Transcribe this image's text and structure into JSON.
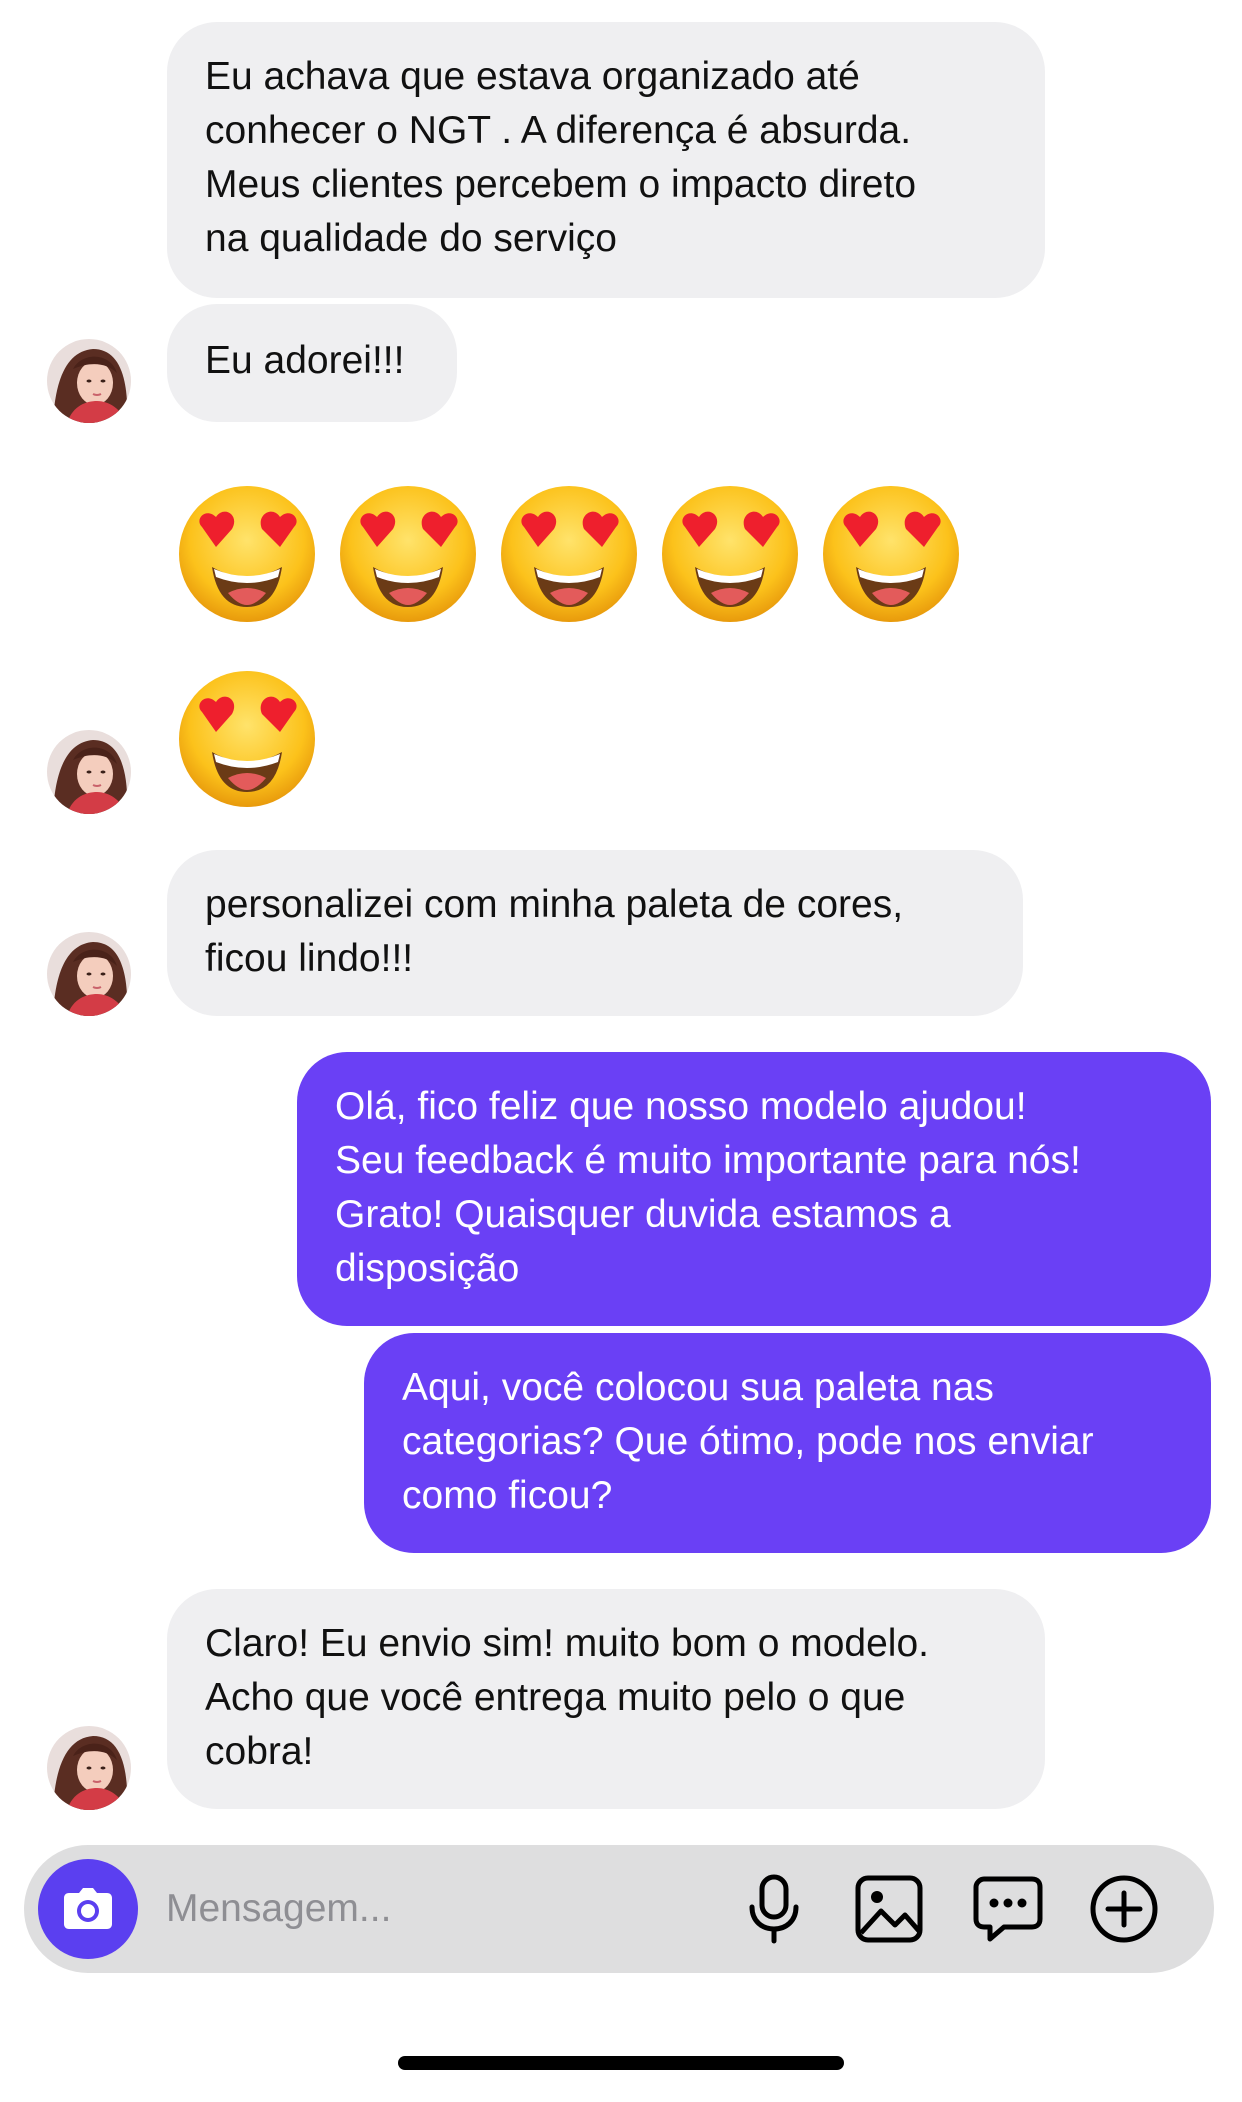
{
  "messages": {
    "m1": "Eu achava que estava organizado até\nconhecer o NGT . A diferença é absurda.\nMeus clientes percebem o impacto direto\nna qualidade do serviço",
    "m2": "Eu adorei!!!",
    "emoji_row1": [
      "😍",
      "😍",
      "😍",
      "😍",
      "😍"
    ],
    "emoji_row2": [
      "😍"
    ],
    "m3": "personalizei com minha paleta de cores,\nficou lindo!!!",
    "m4": "Olá, fico feliz que nosso modelo ajudou!\nSeu feedback é muito importante para nós!\nGrato! Quaisquer duvida estamos a\ndisposição",
    "m5": "Aqui, você colocou sua paleta nas\ncategorias? Que ótimo, pode nos enviar\ncomo ficou?",
    "m6": "Claro! Eu envio sim! muito bom o modelo.\nAcho que você entrega muito pelo o que\ncobra!"
  },
  "composer": {
    "placeholder": "Mensagem...",
    "icons": [
      "camera-icon",
      "microphone-icon",
      "image-icon",
      "chat-bubble-icon",
      "plus-circle-icon"
    ]
  },
  "colors": {
    "incoming_bubble": "#efeff1",
    "outgoing_bubble": "#6a40f5",
    "composer_bg": "#dededf",
    "camera_button": "#5b3ff0"
  }
}
